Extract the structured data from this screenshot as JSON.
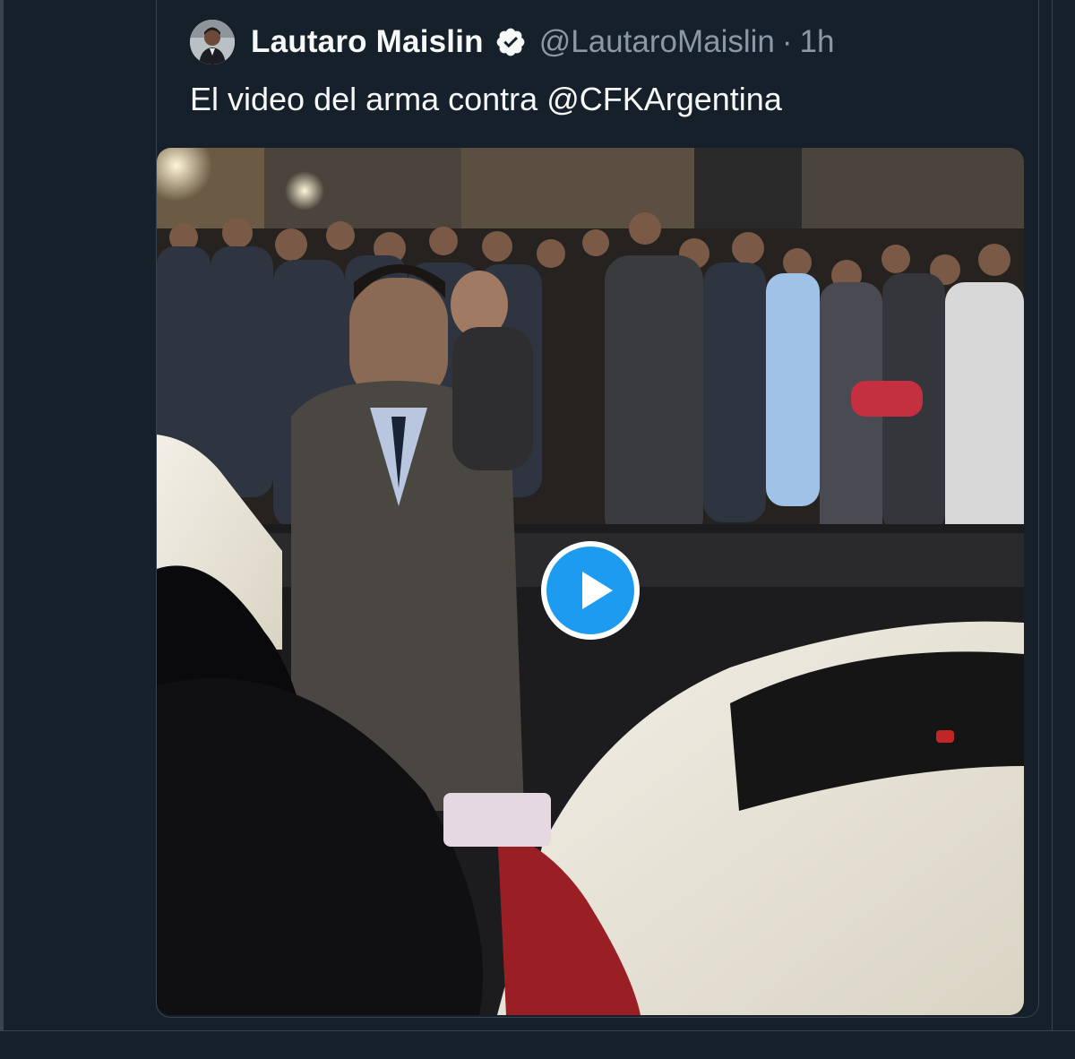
{
  "tweet": {
    "author": {
      "display_name": "Lautaro Maislin",
      "handle": "@LautaroMaislin",
      "separator": "·",
      "time": "1h",
      "verified": true,
      "avatar_icon": "user-avatar-icon"
    },
    "text": "El video del arma contra @CFKArgentina",
    "media": {
      "type": "video",
      "play_icon": "play-icon"
    }
  },
  "colors": {
    "background": "#15202b",
    "border": "#38444d",
    "text_primary": "#f7f9f9",
    "text_secondary": "#8b98a5",
    "accent": "#1d9bf0"
  }
}
